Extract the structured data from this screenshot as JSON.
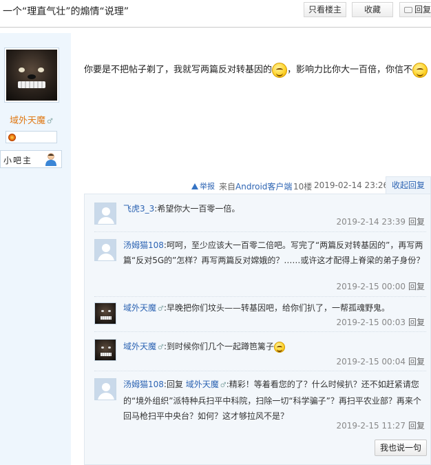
{
  "header": {
    "title": "一个“理直气壮”的煽情“说理”",
    "only_op_label": "只看楼主",
    "collect_label": "收藏",
    "reply_label": "回复"
  },
  "author": {
    "name": "域外天魔",
    "gender_mark": "♂",
    "role": "小吧主"
  },
  "post": {
    "text_part1": "你要是不把帖子剃了，我就写两篇反对转基因的",
    "text_part2": "，影响力比你大一百倍，你信不",
    "report_label": "举报",
    "client_prefix": "来自",
    "client_name": "Android客户端",
    "floor": "10楼",
    "date": "2019-02-14 23:26",
    "collapse_label": "收起回复"
  },
  "comments": [
    {
      "author": "飞虎3_3",
      "gender": "",
      "text": ":希望你大一百零一倍。",
      "time": "2019-2-14 23:39",
      "reply": "回复",
      "avatar": "default"
    },
    {
      "author": "汤姆猫108",
      "gender": "",
      "text": ":呵呵，至少应该大一百零二倍吧。写完了“两篇反对转基因的”，再写两篇“反对5G的”怎样？再写两篇反对嫦娥的？……或许这才配得上脊梁的弟子身份？",
      "time": "2019-2-15 00:00",
      "reply": "回复",
      "avatar": "default"
    },
    {
      "author": "域外天魔",
      "gender": "♂",
      "text": ":早晚把你们坟头——转基因吧，给你们扒了，一帮孤魂野鬼。",
      "time": "2019-2-15 00:03",
      "reply": "回复",
      "avatar": "dog"
    },
    {
      "author": "域外天魔",
      "gender": "♂",
      "text": ":到时候你们几个一起蹲笆篱子",
      "time": "2019-2-15 00:04",
      "reply": "回复",
      "avatar": "dog"
    },
    {
      "author": "汤姆猫108",
      "gender": "",
      "reply_prefix": ":回复 ",
      "reply_to": "域外天魔",
      "reply_to_gender": "♂",
      "text": ":精彩！等着看您的了？什么时候扒？还不如赶紧请您的“境外组织”派特种兵扫平中科院，扫除一切“科学骗子”？再扫平农业部？再来个回马枪扫平中央台？如何？这才够拉风不是？",
      "time": "2019-2-15 11:27",
      "reply": "回复",
      "avatar": "default"
    }
  ],
  "say_button": "我也说一句",
  "icons": [
    "reply-icon",
    "warning-icon",
    "smiley-icon",
    "default-avatar-icon",
    "badge-icon",
    "user-role-icon"
  ]
}
